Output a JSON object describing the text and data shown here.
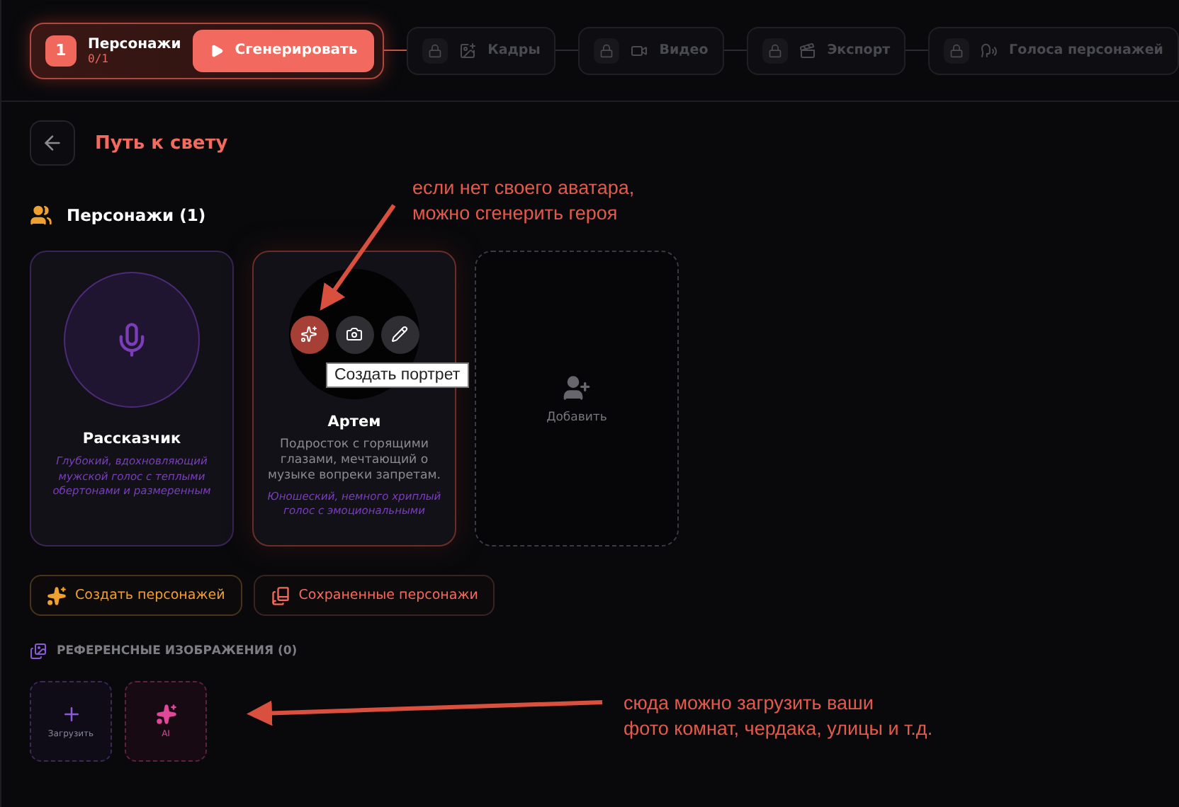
{
  "steps": [
    {
      "kind": "active",
      "number": "1",
      "label": "Персонажи",
      "progress": "0/1",
      "action": "Сгенерировать",
      "locked": false
    },
    {
      "kind": "locked",
      "label": "Кадры",
      "locked": true
    },
    {
      "kind": "locked",
      "label": "Видео",
      "locked": true
    },
    {
      "kind": "locked",
      "label": "Экспорт",
      "locked": true
    },
    {
      "kind": "locked",
      "label": "Голоса персонажей",
      "locked": true
    }
  ],
  "project": {
    "title": "Путь к свету"
  },
  "characters_section": {
    "title": "Персонажи (1)"
  },
  "cards": [
    {
      "kind": "narrator",
      "name": "Рассказчик",
      "voice": "Глубокий, вдохновляющий мужской голос с теплыми обертонами и размеренным"
    },
    {
      "kind": "character",
      "name": "Артем",
      "description": "Подросток с горящими глазами, мечтающий о музыке вопреки запретам.",
      "voice": "Юношеский, немного хриплый голос с эмоциональными",
      "actions": [
        {
          "selected": true
        },
        {
          "selected": false
        },
        {
          "selected": false
        }
      ],
      "tooltip": "Создать портрет"
    },
    {
      "kind": "add",
      "label": "Добавить"
    }
  ],
  "buttons": [
    {
      "kind": "create",
      "label": "Создать персонажей"
    },
    {
      "kind": "saved",
      "label": "Сохраненные персонажи"
    }
  ],
  "references": {
    "title": "РЕФЕРЕНСНЫЕ ИЗОБРАЖЕНИЯ (0)",
    "tiles": [
      {
        "kind": "upload",
        "label": "Загрузить"
      },
      {
        "kind": "ai",
        "label": "AI"
      }
    ]
  },
  "annotations": [
    {
      "text": "если нет своего аватара,\nможно сгенерить героя"
    },
    {
      "text": "сюда можно загрузить ваши\nфото комнат, чердака, улицы и т.д."
    }
  ]
}
